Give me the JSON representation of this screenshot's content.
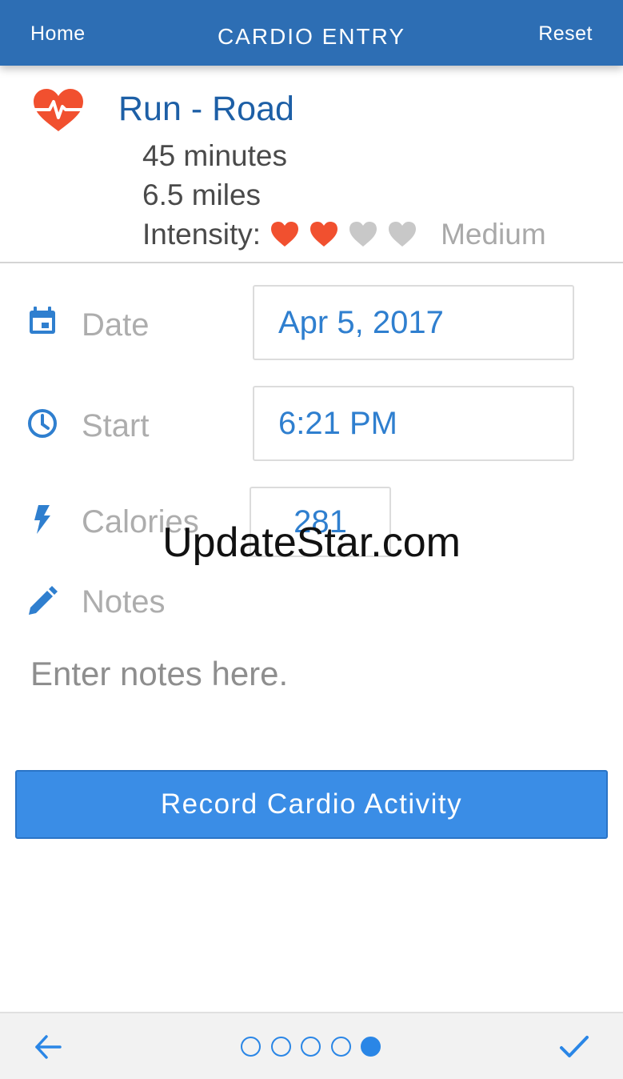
{
  "header": {
    "left_label": "Home",
    "title": "CARDIO ENTRY",
    "right_label": "Reset"
  },
  "summary": {
    "icon": "heart-pulse-icon",
    "activity": "Run - Road",
    "duration": "45 minutes",
    "distance": "6.5 miles",
    "intensity_label": "Intensity:",
    "intensity_level": 2,
    "intensity_max": 5,
    "intensity_text": "Medium"
  },
  "fields": {
    "date": {
      "icon": "calendar-icon",
      "label": "Date",
      "value": "Apr 5, 2017"
    },
    "start": {
      "icon": "clock-icon",
      "label": "Start",
      "value": "6:21 PM"
    },
    "calories": {
      "icon": "lightning-icon",
      "label": "Calories",
      "value": "281"
    },
    "notes": {
      "icon": "pencil-icon",
      "label": "Notes",
      "placeholder": "Enter notes here.",
      "value": ""
    }
  },
  "record_button": "Record Cardio Activity",
  "watermark": "UpdateStar.com",
  "footer": {
    "back_icon": "arrow-left-icon",
    "done_icon": "checkmark-icon",
    "pages_total": 5,
    "current_page": 5
  },
  "colors": {
    "header_bg": "#2d6eb4",
    "accent": "#2f7fcf",
    "heart_active": "#f1502f",
    "heart_inactive": "#c8c8c8",
    "button_bg": "#3a8de6"
  }
}
